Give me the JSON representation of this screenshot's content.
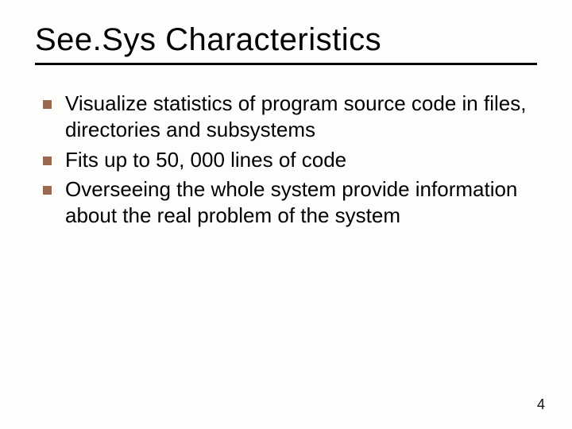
{
  "title": "See.Sys Characteristics",
  "bullets": [
    "Visualize statistics of program source code in files, directories and subsystems",
    "Fits up to 50, 000 lines of code",
    "Overseeing the whole system provide information about the real problem of the system"
  ],
  "page_number": "4"
}
